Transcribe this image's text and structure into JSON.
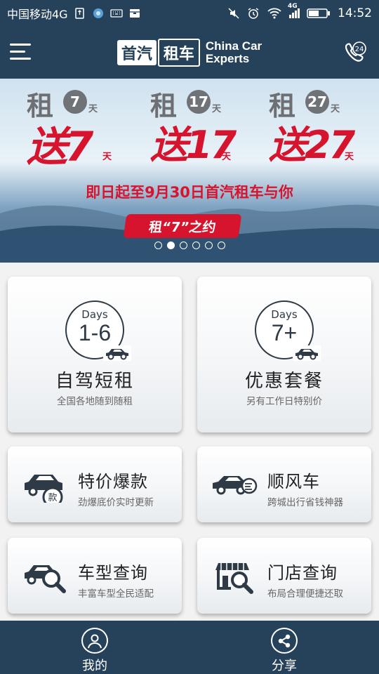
{
  "status_bar": {
    "carrier": "中国移动4G",
    "network": "4G",
    "time": "14:52"
  },
  "header": {
    "logo_cn_1": "首汽",
    "logo_cn_2": "租车",
    "logo_en_1": "China Car",
    "logo_en_2": "Experts",
    "hotline_badge": "24",
    "icons": {
      "menu": "menu-icon",
      "hotline": "phone-24-icon"
    }
  },
  "banner": {
    "promos": [
      {
        "zu": "租",
        "rent_days": "7",
        "tian": "天",
        "song": "送7",
        "free_days_unit": "天"
      },
      {
        "zu": "租",
        "rent_days": "17",
        "tian": "天",
        "song": "送17",
        "free_days_unit": "天"
      },
      {
        "zu": "租",
        "rent_days": "27",
        "tian": "天",
        "song": "送27",
        "free_days_unit": "天"
      }
    ],
    "headline": "即日起至9月30日首汽租车与你",
    "pill": "租“7”之约",
    "dot_count": 6,
    "active_dot": 1
  },
  "services": {
    "short_rent": {
      "days_label": "Days",
      "days_value": "1-6",
      "title": "自驾短租",
      "subtitle": "全国各地随到随租"
    },
    "packages": {
      "days_label": "Days",
      "days_value": "7+",
      "title": "优惠套餐",
      "subtitle": "另有工作日特别价"
    },
    "specials": {
      "title": "特价爆款",
      "subtitle": "劲爆底价实时更新",
      "icon": "car-price-tag-icon",
      "tag": "款"
    },
    "ride_share": {
      "title": "顺风车",
      "subtitle": "跨城出行省钱神器",
      "icon": "fast-car-icon"
    },
    "car_search": {
      "title": "车型查询",
      "subtitle": "丰富车型全民适配",
      "icon": "car-search-icon"
    },
    "store_search": {
      "title": "门店查询",
      "subtitle": "布局合理便捷还取",
      "icon": "store-search-icon"
    }
  },
  "bottom_nav": {
    "mine": {
      "label": "我的",
      "icon": "user-icon"
    },
    "share": {
      "label": "分享",
      "icon": "share-icon"
    }
  },
  "colors": {
    "primary": "#26425a",
    "promo_red": "#d6142e",
    "icon_dark": "#2e3a46"
  }
}
